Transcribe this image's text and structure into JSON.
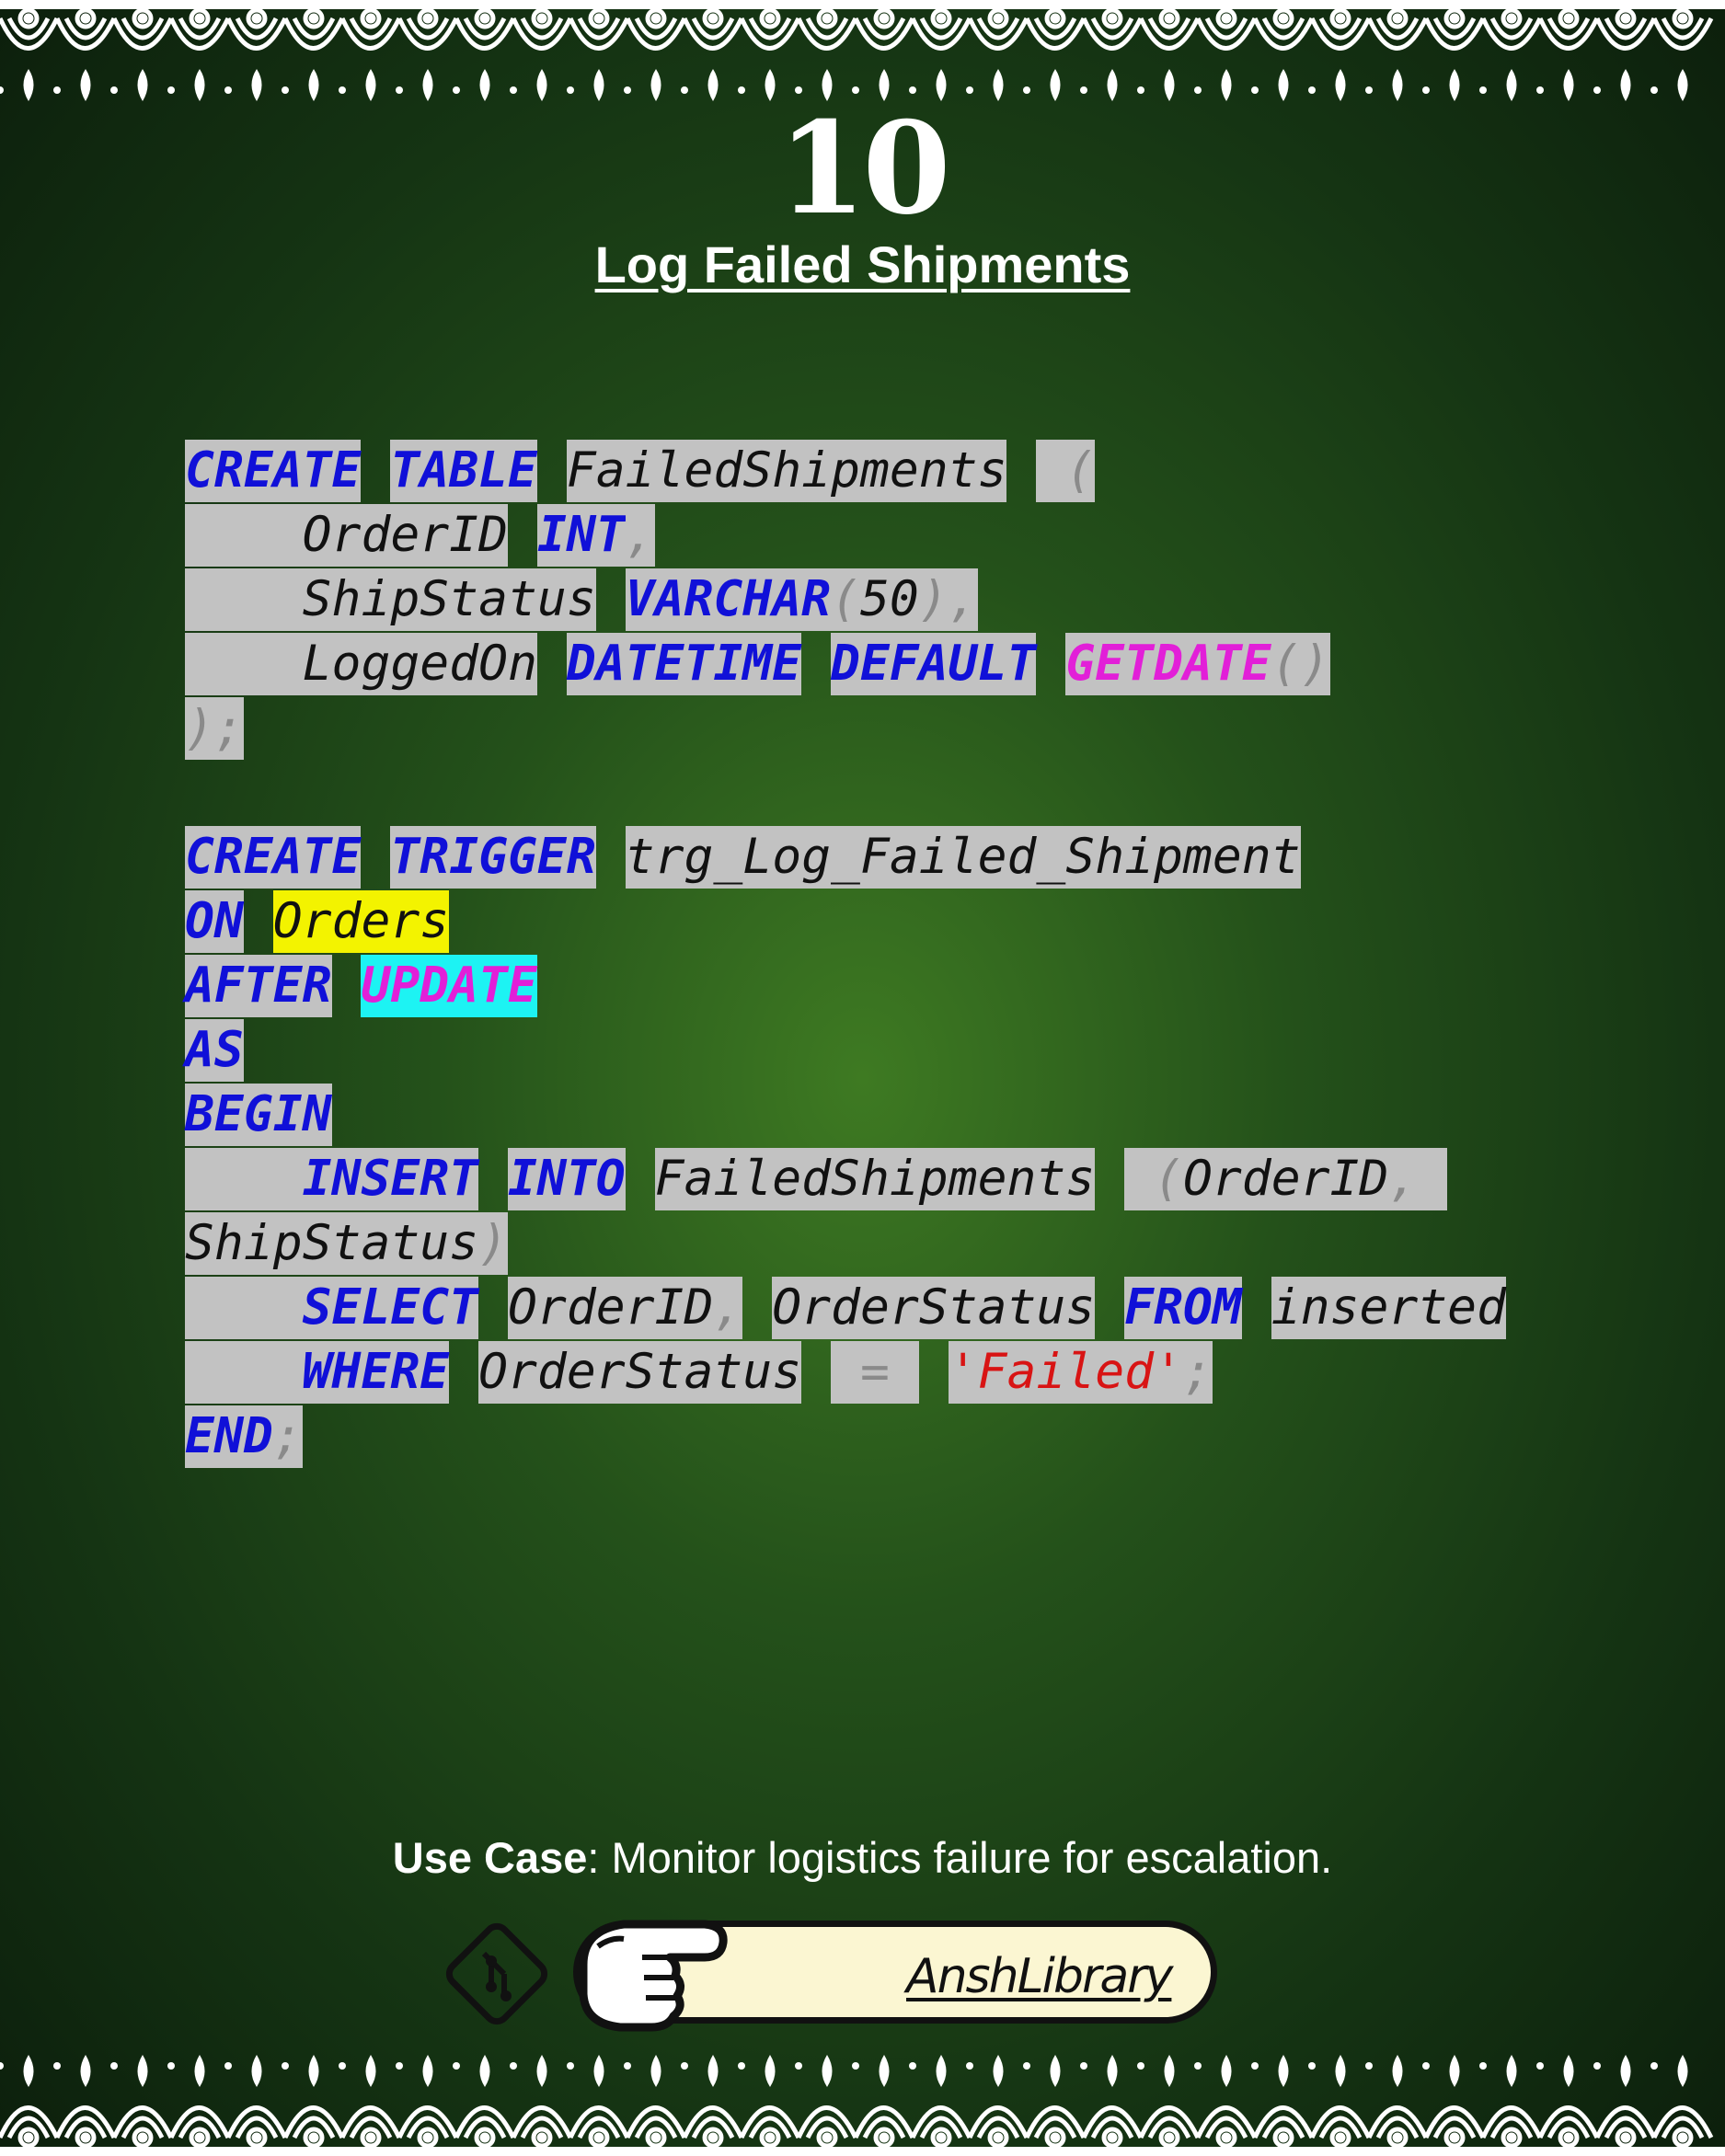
{
  "page_number": "10",
  "title": "Log Failed Shipments",
  "code": [
    [
      {
        "t": "CREATE",
        "c": "kw"
      },
      {
        "t": " ",
        "c": "gap"
      },
      {
        "t": "TABLE",
        "c": "kw"
      },
      {
        "t": " ",
        "c": "gap"
      },
      {
        "t": "FailedShipments",
        "c": "id"
      },
      {
        "t": " ",
        "c": "gap"
      },
      {
        "t": " (",
        "c": "pn"
      }
    ],
    [
      {
        "t": "    ",
        "c": "id"
      },
      {
        "t": "OrderID",
        "c": "id"
      },
      {
        "t": " ",
        "c": "gap"
      },
      {
        "t": "INT",
        "c": "kw"
      },
      {
        "t": ",",
        "c": "pn"
      }
    ],
    [
      {
        "t": "    ",
        "c": "id"
      },
      {
        "t": "ShipStatus",
        "c": "id"
      },
      {
        "t": " ",
        "c": "gap"
      },
      {
        "t": "VARCHAR",
        "c": "kw"
      },
      {
        "t": "(",
        "c": "pn"
      },
      {
        "t": "50",
        "c": "num"
      },
      {
        "t": "),",
        "c": "pn"
      }
    ],
    [
      {
        "t": "    ",
        "c": "id"
      },
      {
        "t": "LoggedOn",
        "c": "id"
      },
      {
        "t": " ",
        "c": "gap"
      },
      {
        "t": "DATETIME",
        "c": "kw"
      },
      {
        "t": " ",
        "c": "gap"
      },
      {
        "t": "DEFAULT",
        "c": "kw"
      },
      {
        "t": " ",
        "c": "gap"
      },
      {
        "t": "GETDATE",
        "c": "fn"
      },
      {
        "t": "()",
        "c": "pn"
      }
    ],
    [
      {
        "t": ");",
        "c": "pn"
      }
    ],
    [],
    [
      {
        "t": "CREATE",
        "c": "kw"
      },
      {
        "t": " ",
        "c": "gap"
      },
      {
        "t": "TRIGGER",
        "c": "kw"
      },
      {
        "t": " ",
        "c": "gap"
      },
      {
        "t": "trg_Log_Failed_Shipment",
        "c": "id"
      }
    ],
    [
      {
        "t": "ON",
        "c": "kw"
      },
      {
        "t": " ",
        "c": "gap"
      },
      {
        "t": "Orders",
        "c": "id hl-y"
      }
    ],
    [
      {
        "t": "AFTER",
        "c": "kw"
      },
      {
        "t": " ",
        "c": "gap"
      },
      {
        "t": "UPDATE",
        "c": "hl-c"
      }
    ],
    [
      {
        "t": "AS",
        "c": "kw"
      }
    ],
    [
      {
        "t": "BEGIN",
        "c": "kw"
      }
    ],
    [
      {
        "t": "    ",
        "c": "id"
      },
      {
        "t": "INSERT",
        "c": "kw"
      },
      {
        "t": " ",
        "c": "gap"
      },
      {
        "t": "INTO",
        "c": "kw"
      },
      {
        "t": " ",
        "c": "gap"
      },
      {
        "t": "FailedShipments",
        "c": "id"
      },
      {
        "t": " ",
        "c": "gap"
      },
      {
        "t": " (",
        "c": "pn"
      },
      {
        "t": "OrderID",
        "c": "id"
      },
      {
        "t": ", ",
        "c": "pn"
      }
    ],
    [
      {
        "t": "ShipStatus",
        "c": "id"
      },
      {
        "t": ")",
        "c": "pn"
      }
    ],
    [
      {
        "t": "    ",
        "c": "id"
      },
      {
        "t": "SELECT",
        "c": "kw"
      },
      {
        "t": " ",
        "c": "gap"
      },
      {
        "t": "OrderID",
        "c": "id"
      },
      {
        "t": ",",
        "c": "pn"
      },
      {
        "t": " ",
        "c": "gap"
      },
      {
        "t": "OrderStatus",
        "c": "id"
      },
      {
        "t": " ",
        "c": "gap"
      },
      {
        "t": "FROM",
        "c": "kw"
      },
      {
        "t": " ",
        "c": "gap"
      },
      {
        "t": "inserted",
        "c": "id"
      }
    ],
    [
      {
        "t": "    ",
        "c": "id"
      },
      {
        "t": "WHERE",
        "c": "kw"
      },
      {
        "t": " ",
        "c": "gap"
      },
      {
        "t": "OrderStatus",
        "c": "id"
      },
      {
        "t": " ",
        "c": "gap"
      },
      {
        "t": " = ",
        "c": "pn"
      },
      {
        "t": " ",
        "c": "gap"
      },
      {
        "t": "'Failed'",
        "c": "str"
      },
      {
        "t": ";",
        "c": "pn"
      }
    ],
    [
      {
        "t": "END",
        "c": "kw"
      },
      {
        "t": ";",
        "c": "pn"
      }
    ]
  ],
  "use_case": {
    "label": "Use Case",
    "text": ": Monitor logistics failure for escalation."
  },
  "branding": {
    "name": "AnshLibrary",
    "icons": [
      "git-icon",
      "pointing-hand-icon"
    ]
  },
  "colors": {
    "background": "#1f4a16",
    "keyword": "#1010d8",
    "function": "#e21fd8",
    "string": "#d81414",
    "punctuation": "#8a8a8a",
    "code_background": "#c2c2c2",
    "highlight_yellow": "#f3f300",
    "highlight_cyan": "#1df3f3",
    "pill": "#fbf6d2"
  }
}
